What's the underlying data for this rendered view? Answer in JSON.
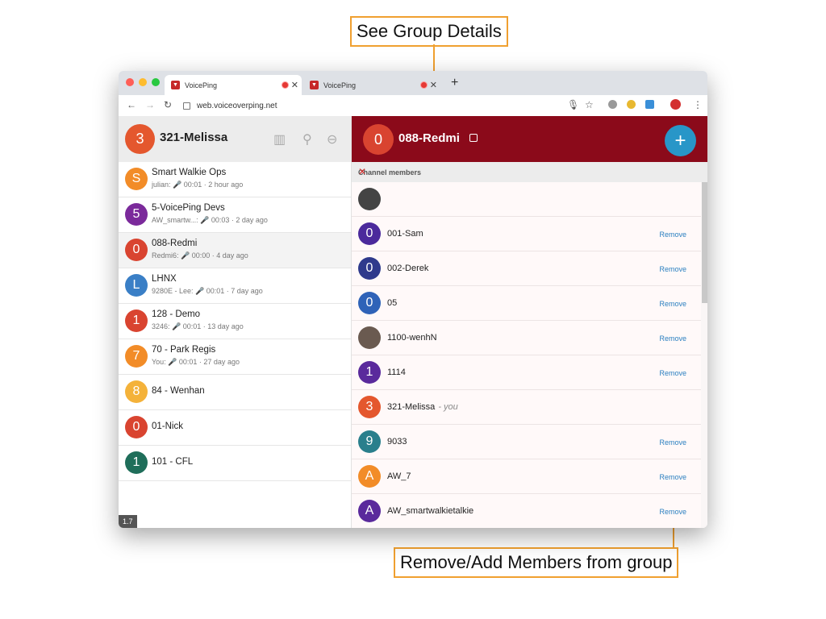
{
  "annotations": {
    "group_details": "See Group Details",
    "remove_add": "Remove/Add Members from group"
  },
  "browser": {
    "tabs": [
      {
        "title": "VoicePing",
        "active": true
      },
      {
        "title": "VoicePing",
        "active": false
      }
    ],
    "new_tab": "+",
    "url": "web.voiceoverping.net"
  },
  "user": {
    "avatar": "3",
    "name": "321-Melissa",
    "color": "#e4572e"
  },
  "channels": [
    {
      "avatar": "S",
      "name": "Smart Walkie Ops",
      "sub": "julian: 🎤 00:01 · 2 hour ago",
      "color": "#f28c28"
    },
    {
      "avatar": "5",
      "name": "5-VoicePing Devs",
      "sub": "AW_smartw...: 🎤 00:03 · 2 day ago",
      "color": "#7b2a9b"
    },
    {
      "avatar": "0",
      "name": "088-Redmi",
      "sub": "Redmi6: 🎤 00:00 · 4 day ago",
      "color": "#d94430",
      "selected": true
    },
    {
      "avatar": "L",
      "name": "LHNX",
      "sub": "9280E - Lee: 🎤 00:01 · 7 day ago",
      "color": "#3a7fc6"
    },
    {
      "avatar": "1",
      "name": "128 - Demo",
      "sub": "3246: 🎤 00:01 · 13 day ago",
      "color": "#d94430"
    },
    {
      "avatar": "7",
      "name": "70 - Park Regis",
      "sub": "You: 🎤 00:01 · 27 day ago",
      "color": "#f28c28"
    },
    {
      "avatar": "8",
      "name": "84 - Wenhan",
      "sub": "",
      "color": "#f4b23a"
    },
    {
      "avatar": "0",
      "name": "01-Nick",
      "sub": "",
      "color": "#d94430"
    },
    {
      "avatar": "1",
      "name": "101 - CFL",
      "sub": "",
      "color": "#1f6e5a"
    }
  ],
  "version": "1.7",
  "channel": {
    "avatar": "0",
    "name": "088-Redmi",
    "header_color": "#8b0a1a",
    "fab": "+"
  },
  "members_header": "Channel members",
  "members": [
    {
      "avatar": "",
      "name": "",
      "remove": "",
      "color": "#444444"
    },
    {
      "avatar": "0",
      "name": "001-Sam",
      "remove": "Remove",
      "color": "#4b2a9c"
    },
    {
      "avatar": "0",
      "name": "002-Derek",
      "remove": "Remove",
      "color": "#2f3a8c"
    },
    {
      "avatar": "0",
      "name": "05",
      "remove": "Remove",
      "color": "#2f63b8"
    },
    {
      "avatar": "",
      "name": "1100-wenhN",
      "remove": "Remove",
      "color": "#6a5a50"
    },
    {
      "avatar": "1",
      "name": "1114",
      "remove": "Remove",
      "color": "#5a2a9c"
    },
    {
      "avatar": "3",
      "name": "321-Melissa",
      "you": "- you",
      "remove": "",
      "color": "#e4572e"
    },
    {
      "avatar": "9",
      "name": "9033",
      "remove": "Remove",
      "color": "#2a7f8c"
    },
    {
      "avatar": "A",
      "name": "AW_7",
      "remove": "Remove",
      "color": "#f28c28"
    },
    {
      "avatar": "A",
      "name": "AW_smartwalkietalkie",
      "remove": "Remove",
      "color": "#5a2a9c"
    }
  ]
}
